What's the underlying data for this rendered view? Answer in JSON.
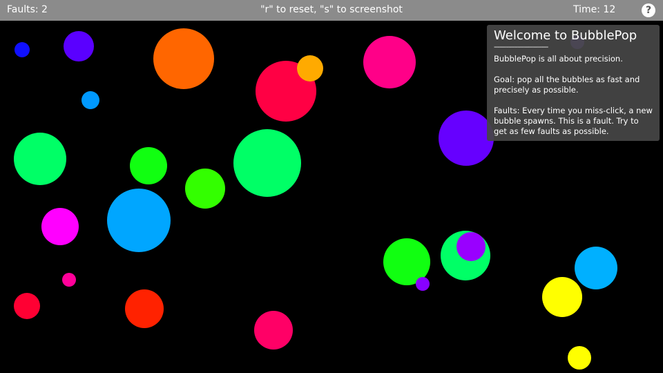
{
  "topbar": {
    "faults": "Faults: 2",
    "hint": "\"r\" to reset, \"s\" to screenshot",
    "time": "Time: 12",
    "help_glyph": "?"
  },
  "help_panel": {
    "title": "Welcome to BubblePop",
    "rule": "------------------------------",
    "paragraphs": [
      "BubblePop is all about precision.",
      "Goal: pop all the bubbles as fast and precisely as possible.",
      "Faults: Every time you miss-click, a new bubble spawns. This is a fault. Try to get as few faults as possible."
    ]
  },
  "colors": {
    "topbar": "#8b8b8b",
    "background": "#000000",
    "panel": "#464646"
  },
  "bubbles": [
    {
      "color": "#1010ff"
    },
    {
      "color": "#5a00ff"
    },
    {
      "color": "#ff6600"
    },
    {
      "color": "#ff0044"
    },
    {
      "color": "#ffaa00"
    },
    {
      "color": "#ff0088"
    },
    {
      "color": "#7c4dff"
    },
    {
      "color": "#0099ff"
    },
    {
      "color": "#00ff66"
    },
    {
      "color": "#11ff11"
    },
    {
      "color": "#00ff66"
    },
    {
      "color": "#33ff00"
    },
    {
      "color": "#6600ff"
    },
    {
      "color": "#ff00ff"
    },
    {
      "color": "#00a6ff"
    },
    {
      "color": "#11ff11"
    },
    {
      "color": "#00ff66"
    },
    {
      "color": "#9900ff"
    },
    {
      "color": "#00b0ff"
    },
    {
      "color": "#ff0099"
    },
    {
      "color": "#8800ff"
    },
    {
      "color": "#ff0033"
    },
    {
      "color": "#ff2200"
    },
    {
      "color": "#ff0066"
    },
    {
      "color": "#ffff00"
    },
    {
      "color": "#ffff00"
    }
  ]
}
